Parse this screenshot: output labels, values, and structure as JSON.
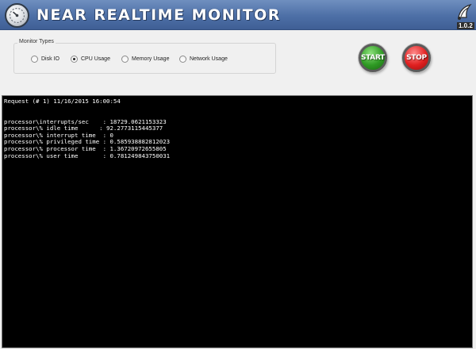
{
  "window": {
    "title": "NEAR REALTIME MONITOR",
    "version": "1.0.2",
    "app_icon": "gauge-icon",
    "brand_icon": "brand-logo-icon"
  },
  "monitor_types": {
    "legend": "Monitor Types",
    "options": [
      {
        "label": "Disk IO",
        "selected": false
      },
      {
        "label": "CPU Usage",
        "selected": true
      },
      {
        "label": "Memory Usage",
        "selected": false
      },
      {
        "label": "Network Usage",
        "selected": false
      }
    ]
  },
  "buttons": {
    "start_label": "START",
    "stop_label": "STOP",
    "start_color": "#2f9a24",
    "stop_color": "#e02020"
  },
  "console": {
    "request_line": "Request (# 1) 11/16/2015 16:00:54",
    "lines": [
      "processor\\interrupts/sec    : 18729.0621153323",
      "processor\\% idle time      : 92.2773115445377",
      "processor\\% interrupt time  : 0",
      "processor\\% privileged time : 0.585938882812023",
      "processor\\% processor time  : 1.36720972655805",
      "processor\\% user time       : 0.781249843750031"
    ]
  }
}
